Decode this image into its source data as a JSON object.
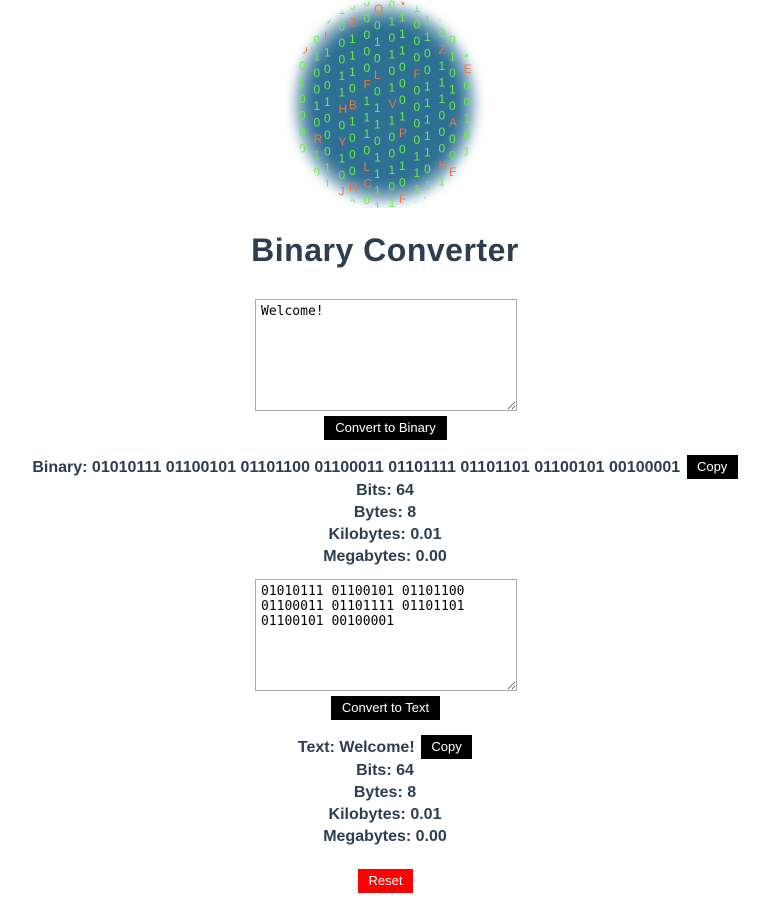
{
  "logo": {
    "icon": "binary-globe-icon",
    "colors": {
      "globe": "#2e6f94",
      "digits": "#66ee44",
      "letters": "#ee7744"
    }
  },
  "page_title": "Binary Converter",
  "text_to_binary": {
    "input_value": "Welcome!",
    "button_label": "Convert to Binary",
    "result_label": "Binary:",
    "result_value": "01010111 01100101 01101100 01100011 01101111 01101101 01100101 00100001",
    "copy_label": "Copy",
    "stats": {
      "bits": "Bits: 64",
      "bytes": "Bytes: 8",
      "kilobytes": "Kilobytes: 0.01",
      "megabytes": "Megabytes: 0.00"
    }
  },
  "binary_to_text": {
    "input_value": "01010111 01100101 01101100 01100011 01101111 01101101 01100101 00100001",
    "button_label": "Convert to Text",
    "result_label": "Text:",
    "result_value": "Welcome!",
    "copy_label": "Copy",
    "stats": {
      "bits": "Bits: 64",
      "bytes": "Bytes: 8",
      "kilobytes": "Kilobytes: 0.01",
      "megabytes": "Megabytes: 0.00"
    }
  },
  "reset_label": "Reset",
  "colors": {
    "text": "#2c3e50",
    "button": "#000000",
    "reset_button": "#ff0000"
  }
}
